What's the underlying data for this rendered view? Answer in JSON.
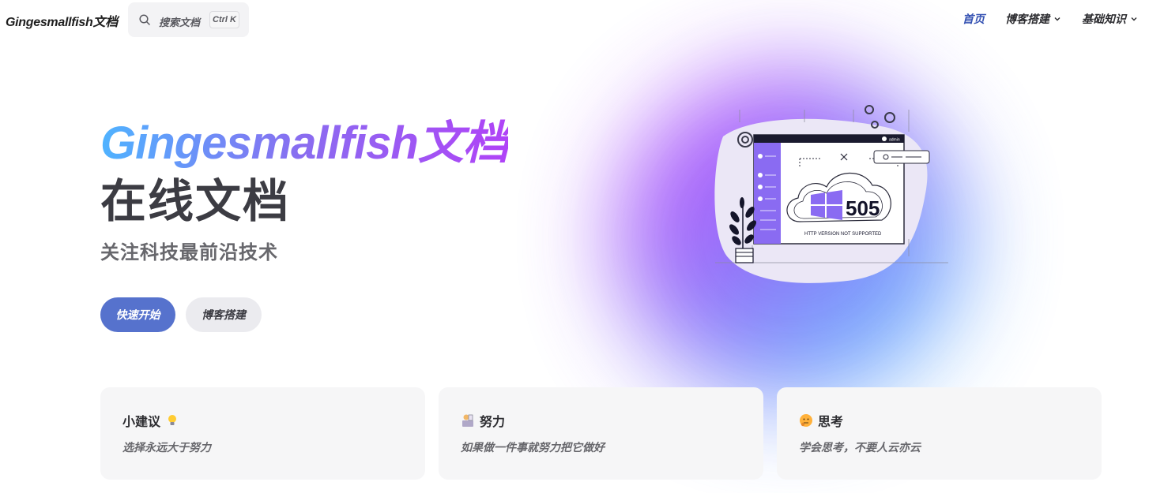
{
  "nav": {
    "logo": "Gingesmallfish文档",
    "search_label": "搜索文档",
    "search_kbd": "Ctrl K",
    "links": [
      {
        "label": "首页",
        "active": true
      },
      {
        "label": "博客搭建"
      },
      {
        "label": "基础知识"
      }
    ]
  },
  "hero": {
    "name": "Gingesmallfish文档",
    "text": "在线文档",
    "tagline": "关注科技最前沿技术",
    "actions": [
      {
        "label": "快速开始"
      },
      {
        "label": "博客搭建"
      }
    ],
    "image": {
      "error_code": "505",
      "error_message": "HTTP VERSION NOT SUPPORTED",
      "user_label": "admin"
    }
  },
  "features": [
    {
      "title": "小建议",
      "icon": "lightbulb-icon",
      "details": "选择永远大于努力"
    },
    {
      "title": "努力",
      "icon": "working-icon",
      "details": "如果做一件事就努力把它做好"
    },
    {
      "title": "思考",
      "icon": "thinking-face-icon",
      "details": "学会思考，不要人云亦云"
    }
  ],
  "colors": {
    "brand": "#5672cd",
    "active_link": "#3451b2",
    "gradient_start": "#4fb3ff",
    "gradient_end": "#b043f7"
  }
}
